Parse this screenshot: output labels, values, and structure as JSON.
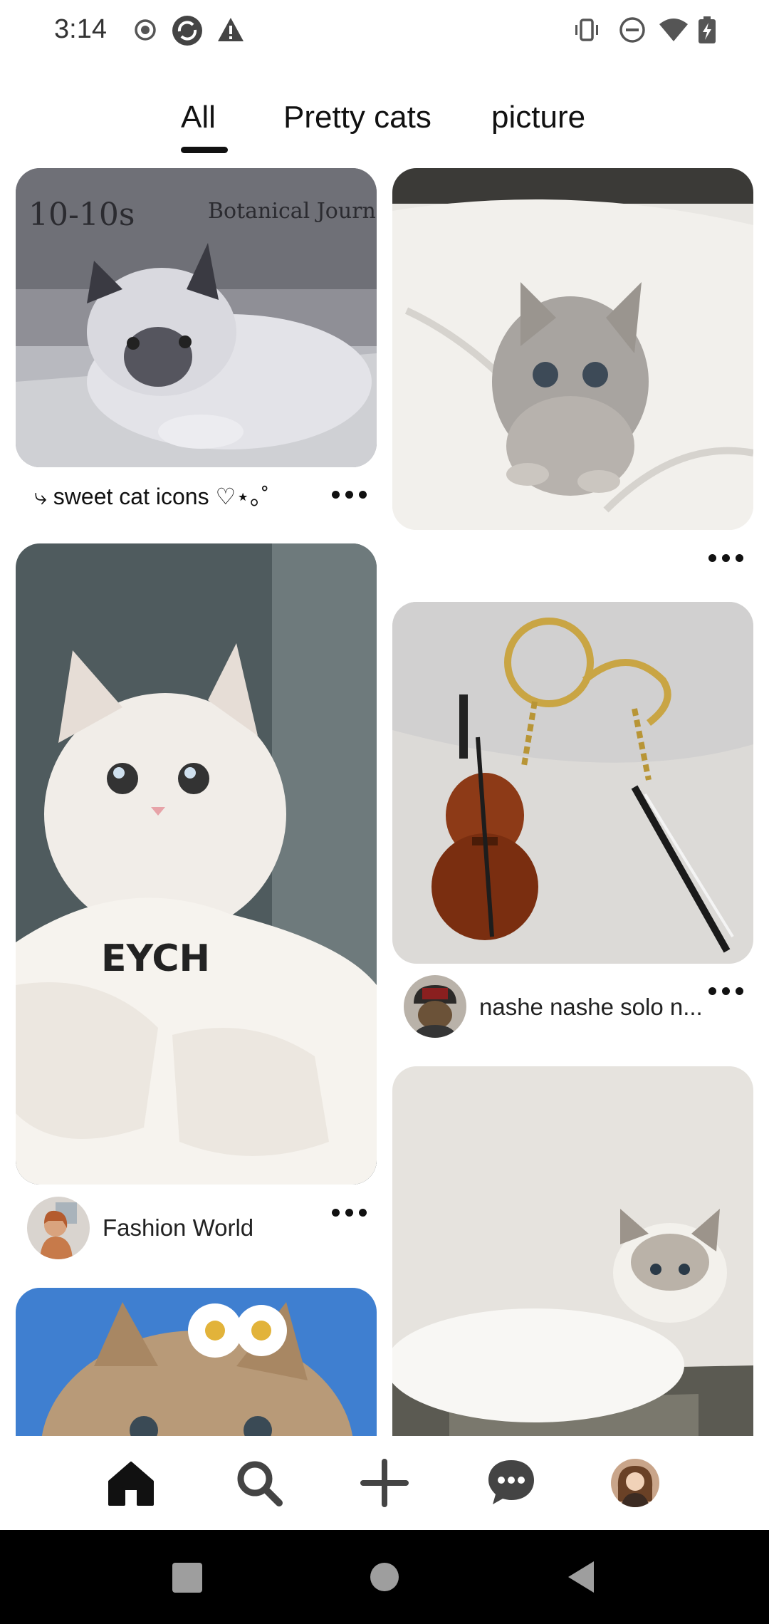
{
  "status_bar": {
    "time": "3:14",
    "left_icons": [
      "record-icon",
      "sync-icon",
      "alert-icon"
    ],
    "right_icons": [
      "vibrate-icon",
      "do-not-disturb-icon",
      "wifi-icon",
      "battery-charging-icon"
    ]
  },
  "tabs": [
    {
      "label": "All",
      "selected": true
    },
    {
      "label": "Pretty cats",
      "selected": false
    },
    {
      "label": "picture",
      "selected": false
    }
  ],
  "feed": {
    "left_column": [
      {
        "image": "siamese-kitten-on-journal-photo",
        "title": "⤷ sweet cat icons ♡⋆｡˚",
        "more_icon": "more-options-icon"
      },
      {
        "image": "white-kitten-in-hoodie-photo",
        "author": "Fashion World",
        "more_icon": "more-options-icon"
      },
      {
        "image": "cat-with-daisies-photo"
      }
    ],
    "right_column": [
      {
        "image": "grey-kitten-on-bed-photo",
        "more_icon": "more-options-icon"
      },
      {
        "image": "violin-keychain-photo",
        "author": "nashe nashe solo n...",
        "more_icon": "more-options-icon"
      },
      {
        "image": "ragdoll-cat-in-basket-photo"
      }
    ]
  },
  "bottom_nav": [
    "home-icon",
    "search-icon",
    "create-icon",
    "messages-icon",
    "profile-avatar"
  ],
  "system_nav": [
    "recents-button",
    "home-button",
    "back-button"
  ],
  "colors": {
    "text": "#111111",
    "background": "#ffffff",
    "system_bar": "#000000"
  }
}
